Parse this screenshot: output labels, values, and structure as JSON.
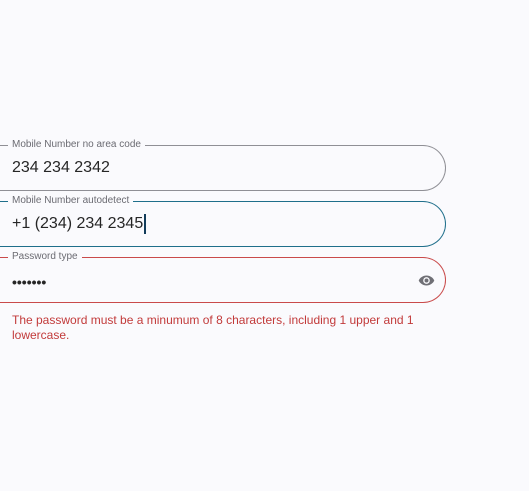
{
  "fields": [
    {
      "label": "Mobile Number no area code",
      "value": "234 234 2342",
      "state": "default"
    },
    {
      "label": "Mobile Number autodetect",
      "value": "+1 (234) 234 2345",
      "state": "focused"
    },
    {
      "label": "Password type",
      "value": "•••••••",
      "state": "error",
      "trailing_icon": "eye-icon"
    }
  ],
  "error_message": "The password must be a minumum of 8 characters, including 1 upper and 1 lowercase.",
  "colors": {
    "background": "#fafafd",
    "default_border": "#8f8f95",
    "focus_border": "#1f6f8b",
    "error": "#c94a4a",
    "error_text": "#c23a3a"
  }
}
